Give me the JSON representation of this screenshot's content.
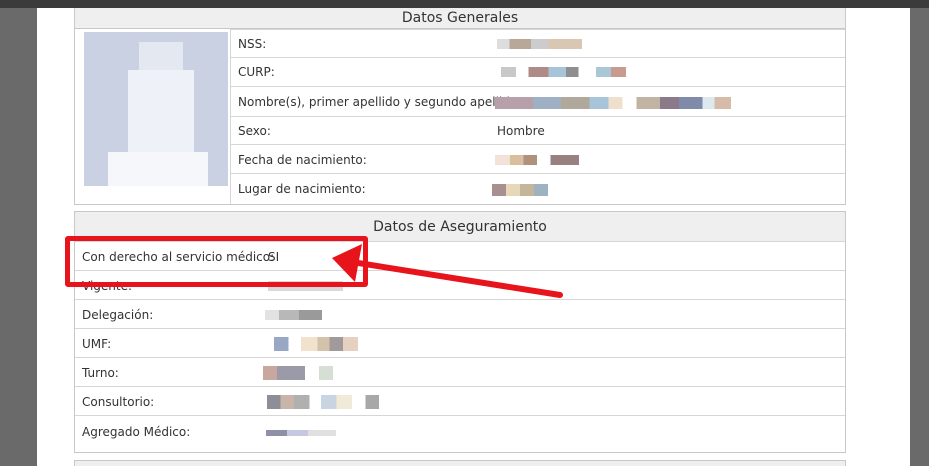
{
  "general": {
    "title": "Datos Generales",
    "fields": [
      {
        "label": "NSS:"
      },
      {
        "label": "CURP:"
      },
      {
        "label": "Nombre(s), primer apellido y segundo apellido:"
      },
      {
        "label": "Sexo:",
        "value": "Hombre"
      },
      {
        "label": "Fecha de nacimiento:"
      },
      {
        "label": "Lugar de nacimiento:"
      }
    ]
  },
  "aseguramiento": {
    "title": "Datos de Aseguramiento",
    "fields": [
      {
        "label": "Con derecho al servicio médico:",
        "value": "SI"
      },
      {
        "label": "Vigente:"
      },
      {
        "label": "Delegación:"
      },
      {
        "label": "UMF:"
      },
      {
        "label": "Turno:"
      },
      {
        "label": "Consultorio:"
      },
      {
        "label": "Agregado Médico:"
      }
    ]
  },
  "annotation_color": "#e8141b"
}
